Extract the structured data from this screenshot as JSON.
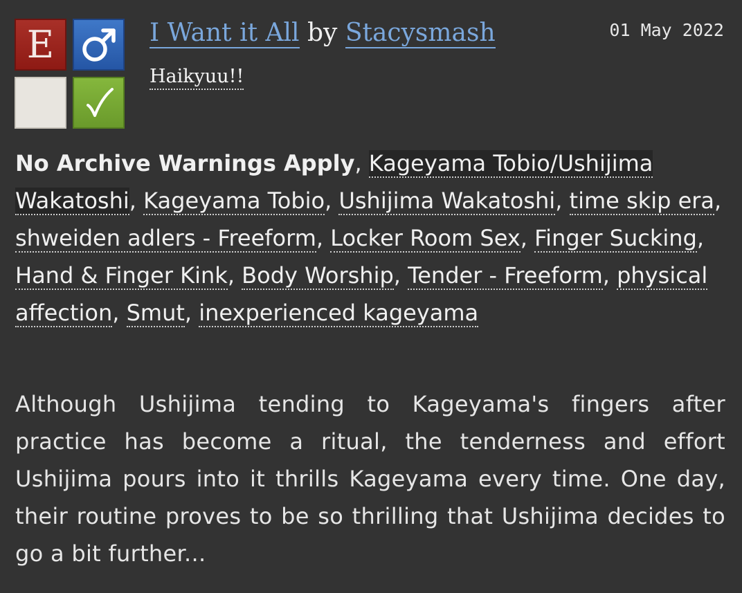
{
  "symbols": {
    "rating": {
      "letter": "E",
      "color": "#9b231c"
    },
    "category": {
      "glyph": "♂",
      "color": "#2f64b4",
      "icon": "male-symbol-icon"
    },
    "warning": {
      "color": "#e8e5df"
    },
    "complete": {
      "glyph": "✓",
      "color": "#78a834",
      "icon": "checkmark-icon"
    }
  },
  "work": {
    "title": "I Want it All",
    "by": "by",
    "author": "Stacysmash",
    "date": "01 May 2022",
    "fandom": "Haikyuu!!"
  },
  "tags": [
    {
      "text": "No Archive Warnings Apply",
      "sep": ",  "
    },
    {
      "text": "Kageyama Tobio/Ushijima Wakatoshi",
      "sep": ",  "
    },
    {
      "text": "Kageyama Tobio",
      "sep": ",  "
    },
    {
      "text": "Ushijima Wakatoshi",
      "sep": ",  "
    },
    {
      "text": "time skip era",
      "sep": ",  "
    },
    {
      "text": "shweiden adlers - Freeform",
      "sep": ", "
    },
    {
      "text": "Locker Room Sex",
      "sep": ",  "
    },
    {
      "text": "Finger Sucking",
      "sep": ",  "
    },
    {
      "text": "Hand & Finger Kink",
      "sep": ", "
    },
    {
      "text": "Body Worship",
      "sep": ",  "
    },
    {
      "text": "Tender - Freeform",
      "sep": ",  "
    },
    {
      "text": "physical affection",
      "sep": ", "
    },
    {
      "text": "Smut",
      "sep": ",  "
    },
    {
      "text": "inexperienced kageyama",
      "sep": ""
    }
  ],
  "summary": "Although Ushijima tending to Kageyama's fingers after practice has become a ritual, the tenderness and effort Ushijima pours into it thrills Kageyama every time. One day, their routine proves to be so thrilling that Ushijima decides to go a bit further..."
}
